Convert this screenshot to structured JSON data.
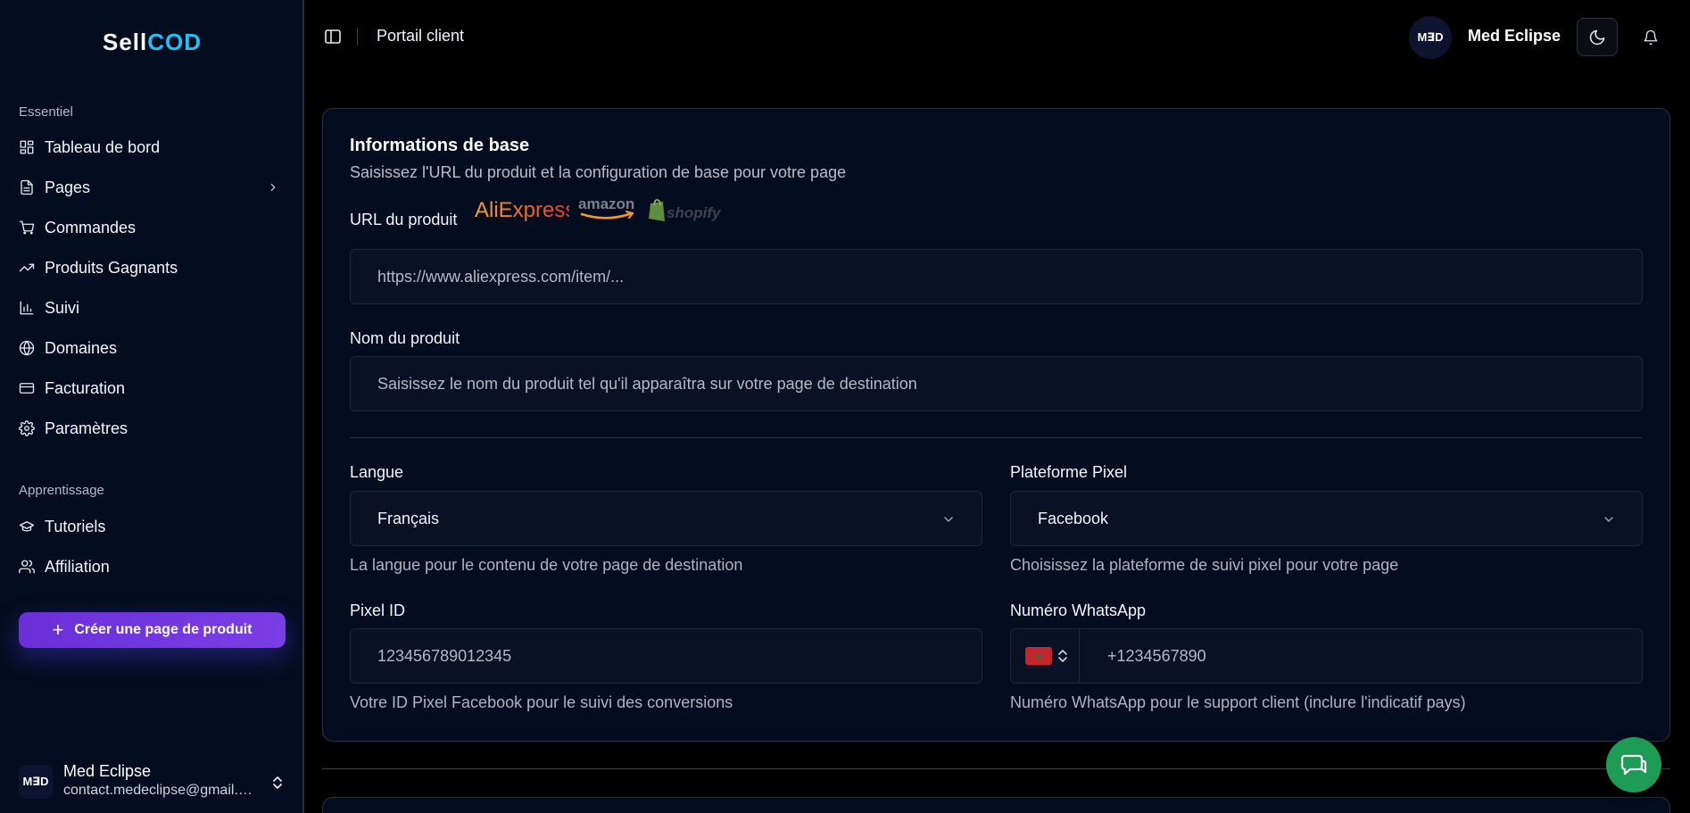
{
  "sidebar": {
    "logo_left": "Sell",
    "logo_right": "COD",
    "section_essentiel": "Essentiel",
    "items": [
      {
        "label": "Tableau de bord",
        "icon": "dashboard-icon"
      },
      {
        "label": "Pages",
        "icon": "file-icon"
      },
      {
        "label": "Commandes",
        "icon": "cart-icon"
      },
      {
        "label": "Produits Gagnants",
        "icon": "trending-up-icon"
      },
      {
        "label": "Suivi",
        "icon": "bar-chart-icon"
      },
      {
        "label": "Domaines",
        "icon": "globe-icon"
      },
      {
        "label": "Facturation",
        "icon": "credit-card-icon"
      },
      {
        "label": "Paramètres",
        "icon": "gear-icon"
      }
    ],
    "section_apprentissage": "Apprentissage",
    "learn_items": [
      {
        "label": "Tutoriels",
        "icon": "graduation-cap-icon"
      },
      {
        "label": "Affiliation",
        "icon": "users-icon"
      }
    ],
    "create_button": "Créer une page de produit",
    "user": {
      "initials": "M∃D",
      "name": "Med Eclipse",
      "email": "contact.medeclipse@gmail.com"
    }
  },
  "header": {
    "title": "Portail client",
    "user_name": "Med Eclipse",
    "avatar_initials": "M∃D"
  },
  "form": {
    "title": "Informations de base",
    "subtitle": "Saisissez l'URL du produit et la configuration de base pour votre page",
    "url_label": "URL du produit",
    "brands": [
      "AliExpress",
      "amazon",
      "shopify"
    ],
    "url_placeholder": "https://www.aliexpress.com/item/...",
    "name_label": "Nom du produit",
    "name_placeholder": "Saisissez le nom du produit tel qu'il apparaîtra sur votre page de destination",
    "langue_label": "Langue",
    "langue_value": "Français",
    "langue_hint": "La langue pour le contenu de votre page de destination",
    "pixel_platform_label": "Plateforme Pixel",
    "pixel_platform_value": "Facebook",
    "pixel_platform_hint": "Choisissez la plateforme de suivi pixel pour votre page",
    "pixel_id_label": "Pixel ID",
    "pixel_id_placeholder": "123456789012345",
    "pixel_id_hint": "Votre ID Pixel Facebook pour le suivi des conversions",
    "whatsapp_label": "Numéro WhatsApp",
    "whatsapp_placeholder": "+1234567890",
    "whatsapp_hint": "Numéro WhatsApp pour le support client (inclure l'indicatif pays)"
  },
  "colors": {
    "accent_purple": "#6a2fd8",
    "logo_cyan": "#1ec1f2",
    "chat_green": "#1d9c55"
  }
}
